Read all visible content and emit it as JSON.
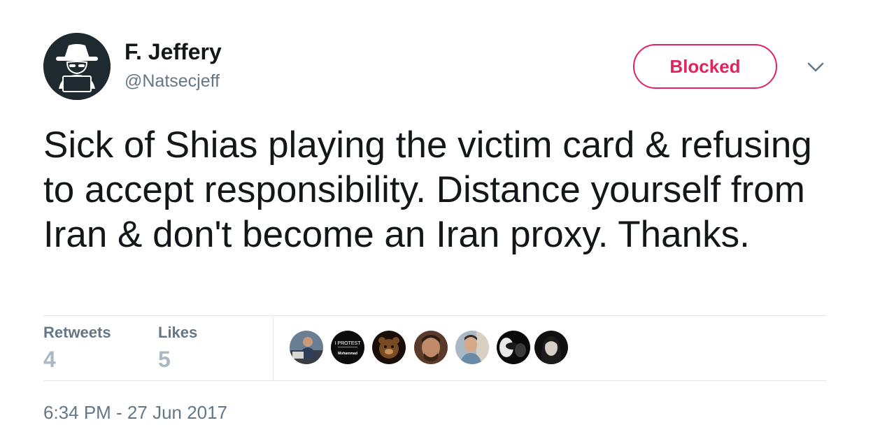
{
  "tweet": {
    "author": {
      "display_name": "F. Jeffery",
      "handle": "@Natsecjeff",
      "avatar_icon": "hacker-hat-icon"
    },
    "follow_state_label": "Blocked",
    "menu_icon": "chevron-down-icon",
    "text": "Sick of Shias playing the victim card & refusing to accept responsibility. Distance yourself from Iran & don't become an Iran proxy. Thanks.",
    "stats": {
      "retweets_label": "Retweets",
      "retweets_count": "4",
      "likes_label": "Likes",
      "likes_count": "5"
    },
    "liker_avatars": [
      {
        "name": "liker-avatar-1"
      },
      {
        "name": "liker-avatar-2",
        "text_line1": "I PROTEST",
        "text_line2": "Mohammad"
      },
      {
        "name": "liker-avatar-3"
      },
      {
        "name": "liker-avatar-4"
      },
      {
        "name": "liker-avatar-5"
      },
      {
        "name": "liker-avatar-6"
      },
      {
        "name": "liker-avatar-7"
      }
    ],
    "timestamp": "6:34 PM - 27 Jun 2017"
  },
  "colors": {
    "blocked_red": "#e0245e",
    "secondary_text": "#657786",
    "stat_value": "#aab8c2",
    "divider": "#e1e8ed"
  }
}
